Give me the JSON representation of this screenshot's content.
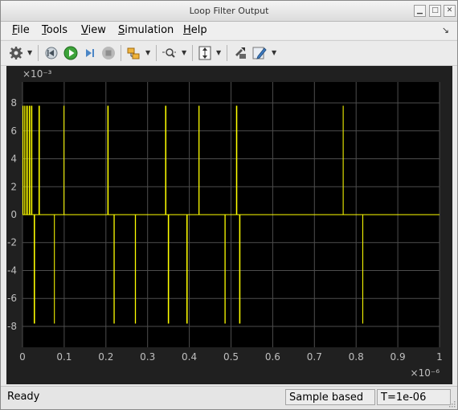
{
  "window": {
    "title": "Loop Filter Output"
  },
  "menu": [
    {
      "label": "File",
      "underline": "F",
      "rest": "ile"
    },
    {
      "label": "Tools",
      "underline": "T",
      "rest": "ools"
    },
    {
      "label": "View",
      "underline": "V",
      "rest": "iew"
    },
    {
      "label": "Simulation",
      "underline": "S",
      "rest": "imulation"
    },
    {
      "label": "Help",
      "underline": "H",
      "rest": "elp"
    }
  ],
  "toolbar_icons": [
    "gear-icon",
    "step-back-icon",
    "run-icon",
    "step-forward-icon",
    "stop-icon",
    "signal-selector-icon",
    "zoom-icon",
    "scale-axes-icon",
    "highlight-block-icon",
    "style-icon"
  ],
  "colors": {
    "plot_bg": "#000000",
    "axes_panel": "#202020",
    "trace": "#ffff00",
    "grid": "#4d4d4d",
    "tick_text": "#bfbfbf"
  },
  "chart_data": {
    "type": "line",
    "series": [
      {
        "color": "#ffff00",
        "pulses_positive": [
          {
            "x": 0.0,
            "w": 0.002
          },
          {
            "x": 0.0035,
            "w": 0.002
          },
          {
            "x": 0.0075,
            "w": 0.0025
          },
          {
            "x": 0.0115,
            "w": 0.002
          },
          {
            "x": 0.0155,
            "w": 0.003
          },
          {
            "x": 0.0205,
            "w": 0.003
          },
          {
            "x": 0.0385,
            "w": 0.003
          },
          {
            "x": 0.0985,
            "w": 0.002
          },
          {
            "x": 0.2035,
            "w": 0.003
          },
          {
            "x": 0.342,
            "w": 0.003
          },
          {
            "x": 0.422,
            "w": 0.0025
          },
          {
            "x": 0.512,
            "w": 0.003
          },
          {
            "x": 0.768,
            "w": 0.002
          }
        ],
        "pulses_negative": [
          {
            "x": 0.027,
            "w": 0.003
          },
          {
            "x": 0.0755,
            "w": 0.002
          },
          {
            "x": 0.2185,
            "w": 0.0025
          },
          {
            "x": 0.2695,
            "w": 0.0025
          },
          {
            "x": 0.3485,
            "w": 0.003
          },
          {
            "x": 0.393,
            "w": 0.003
          },
          {
            "x": 0.4845,
            "w": 0.0025
          },
          {
            "x": 0.5195,
            "w": 0.003
          },
          {
            "x": 0.815,
            "w": 0.002
          }
        ],
        "amplitude": 7.8
      }
    ],
    "x_unit_exponent": "×10⁻⁶",
    "y_unit_exponent": "×10⁻³",
    "xlim": [
      0,
      1
    ],
    "ylim": [
      -9.5,
      9.5
    ],
    "xticks": [
      0,
      0.1,
      0.2,
      0.3,
      0.4,
      0.5,
      0.6,
      0.7,
      0.8,
      0.9,
      1
    ],
    "xtick_labels": [
      "0",
      "0.1",
      "0.2",
      "0.3",
      "0.4",
      "0.5",
      "0.6",
      "0.7",
      "0.8",
      "0.9",
      "1"
    ],
    "yticks": [
      8,
      6,
      4,
      2,
      0,
      -2,
      -4,
      -6,
      -8
    ],
    "ytick_labels": [
      "8",
      "6",
      "4",
      "2",
      "0",
      "-2",
      "-4",
      "-6",
      "-8"
    ],
    "grid": true
  },
  "status": {
    "ready": "Ready",
    "sample_mode": "Sample based",
    "time": "T=1e-06"
  }
}
